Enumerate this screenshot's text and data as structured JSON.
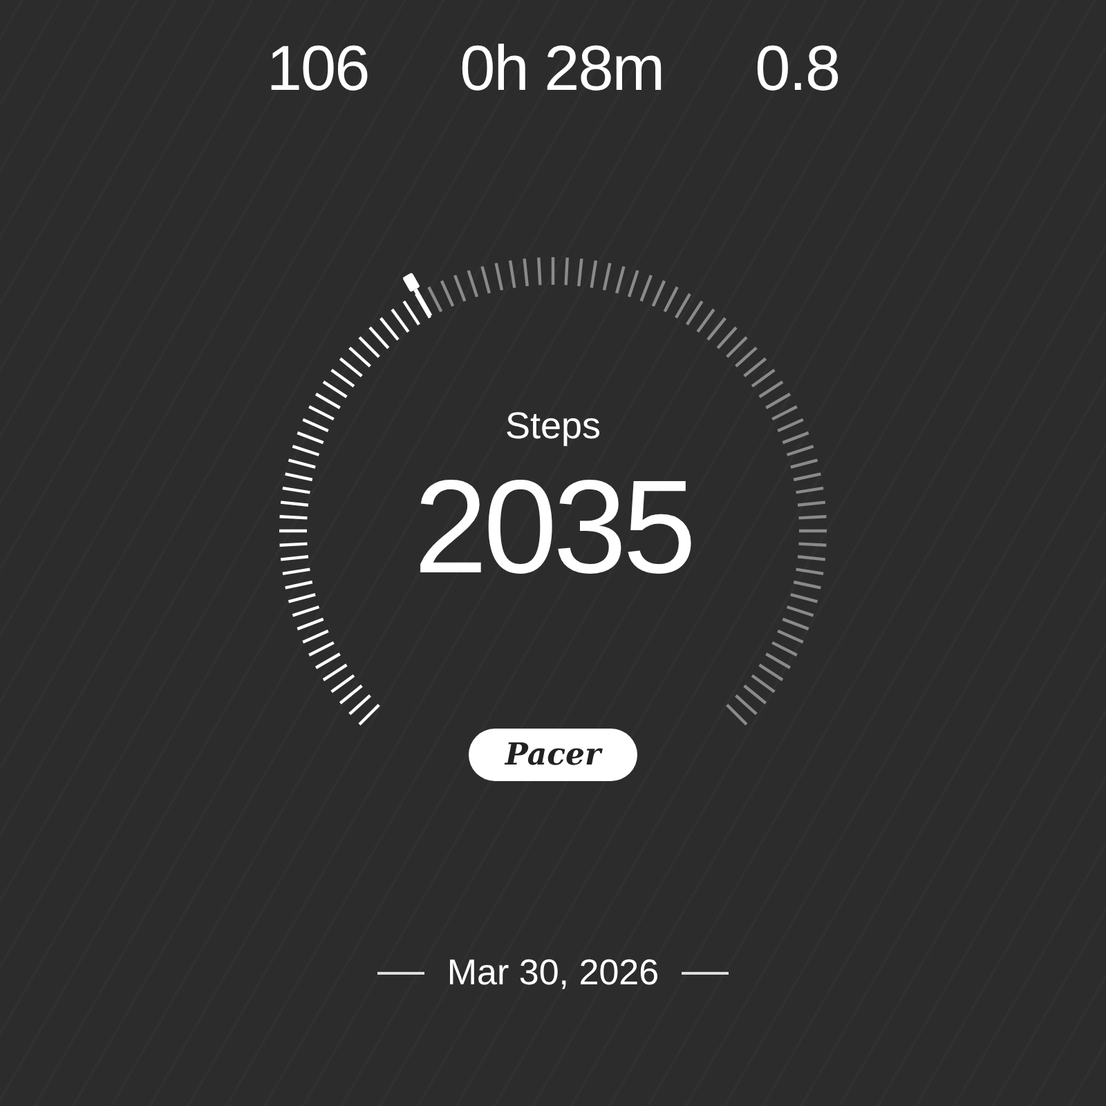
{
  "stats": [
    {
      "value": "106"
    },
    {
      "value": "0h 28m"
    },
    {
      "value": "0.8"
    }
  ],
  "gauge": {
    "label": "Steps",
    "value": "2035"
  },
  "logo": "Pacer",
  "date": "Mar 30, 2026"
}
